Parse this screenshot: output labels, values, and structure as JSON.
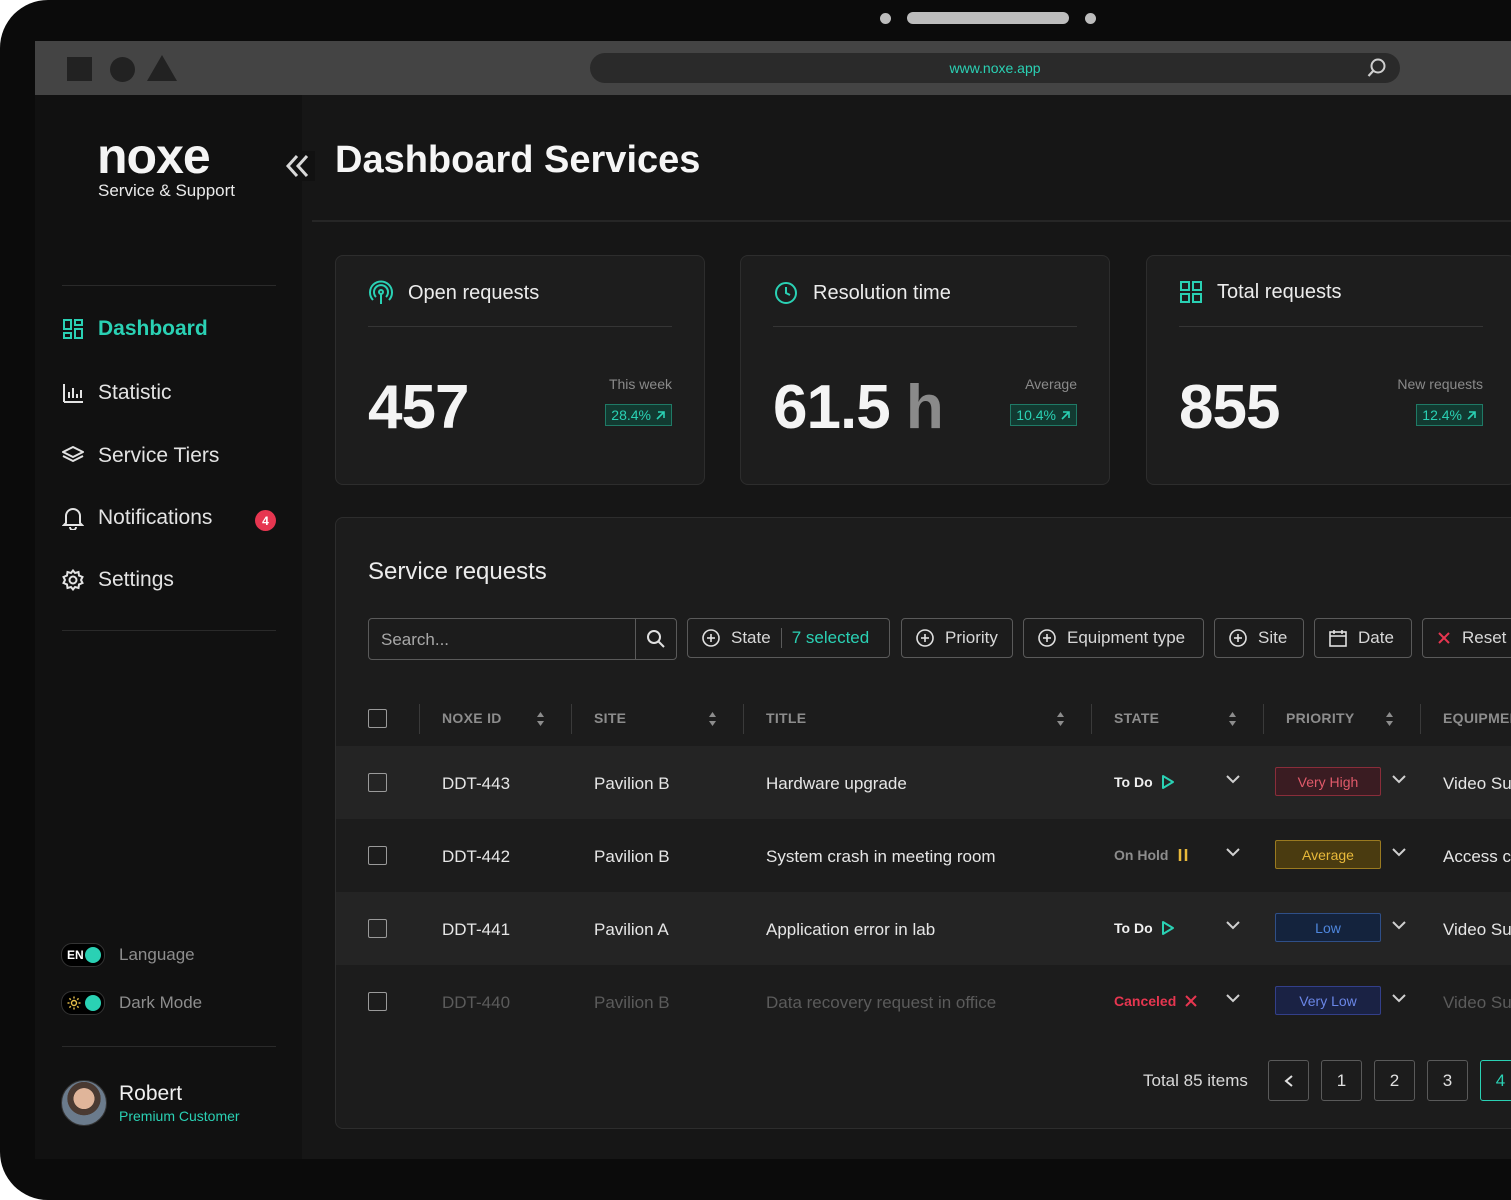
{
  "browser": {
    "url": "www.noxe.app"
  },
  "brand": {
    "name": "noxe",
    "tagline": "Service & Support",
    "accent": "#2ad1b4"
  },
  "sidebar": {
    "items": [
      {
        "label": "Dashboard",
        "icon": "grid-icon",
        "active": true
      },
      {
        "label": "Statistic",
        "icon": "bar-chart-icon"
      },
      {
        "label": "Service Tiers",
        "icon": "layers-icon"
      },
      {
        "label": "Notifications",
        "icon": "bell-icon",
        "badge": "4"
      },
      {
        "label": "Settings",
        "icon": "gear-icon"
      }
    ],
    "language": {
      "code": "EN",
      "label": "Language"
    },
    "dark_mode": {
      "label": "Dark Mode",
      "on": true
    },
    "user": {
      "name": "Robert",
      "role": "Premium Customer"
    }
  },
  "page": {
    "title": "Dashboard Services"
  },
  "cards": [
    {
      "title": "Open requests",
      "icon": "signal-icon",
      "value": "457",
      "unit": "",
      "meta_label": "This week",
      "delta": "28.4%"
    },
    {
      "title": "Resolution time",
      "icon": "clock-icon",
      "value": "61.5",
      "unit": "h",
      "meta_label": "Average",
      "delta": "10.4%"
    },
    {
      "title": "Total requests",
      "icon": "grid-icon",
      "value": "855",
      "unit": "",
      "meta_label": "New requests",
      "delta": "12.4%"
    }
  ],
  "requests": {
    "title": "Service requests",
    "search_placeholder": "Search...",
    "filters": {
      "state": "State",
      "state_selected": "7 selected",
      "priority": "Priority",
      "equipment": "Equipment type",
      "site": "Site",
      "date": "Date",
      "reset": "Reset"
    },
    "columns": {
      "id": "NOXE ID",
      "site": "SITE",
      "title": "TITLE",
      "state": "STATE",
      "priority": "PRIORITY",
      "equipment": "EQUIPMEN"
    },
    "rows": [
      {
        "id": "DDT-443",
        "site": "Pavilion B",
        "title": "Hardware upgrade",
        "state": "To Do",
        "priority": "Very High",
        "equipment": "Video Su"
      },
      {
        "id": "DDT-442",
        "site": "Pavilion B",
        "title": "System crash in meeting room",
        "state": "On Hold",
        "priority": "Average",
        "equipment": "Access c"
      },
      {
        "id": "DDT-441",
        "site": "Pavilion A",
        "title": "Application error in lab",
        "state": "To Do",
        "priority": "Low",
        "equipment": "Video Su"
      },
      {
        "id": "DDT-440",
        "site": "Pavilion B",
        "title": "Data recovery request in office",
        "state": "Canceled",
        "priority": "Very Low",
        "equipment": "Video Su"
      }
    ],
    "total": "Total 85 items",
    "pages": [
      "1",
      "2",
      "3",
      "4"
    ],
    "current_page": "4"
  }
}
